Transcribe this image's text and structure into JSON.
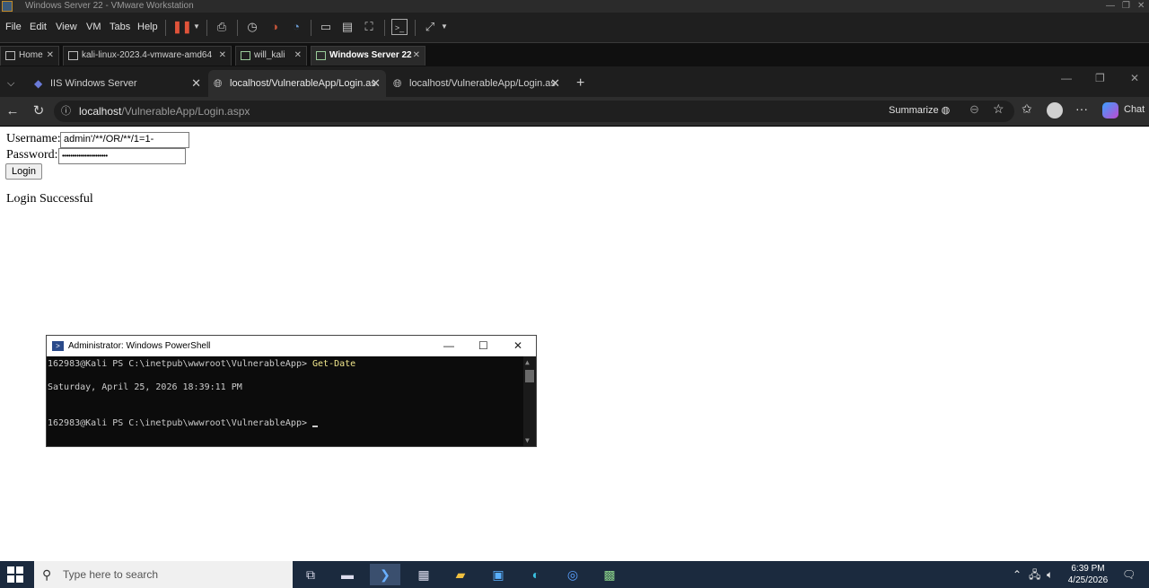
{
  "vmware": {
    "title": "Windows Server 22 - VMware Workstation",
    "menu": [
      "File",
      "Edit",
      "View",
      "VM",
      "Tabs",
      "Help"
    ],
    "tabs": [
      {
        "label": "Home",
        "active": false
      },
      {
        "label": "kali-linux-2023.4-vmware-amd64",
        "active": false
      },
      {
        "label": "will_kali",
        "active": false
      },
      {
        "label": "Windows Server 22",
        "active": true
      }
    ]
  },
  "browser": {
    "tabs": [
      {
        "label": "IIS Windows Server",
        "active": false
      },
      {
        "label": "localhost/VulnerableApp/Login.as",
        "active": true
      },
      {
        "label": "localhost/VulnerableApp/Login.as",
        "active": false
      }
    ],
    "address": {
      "host": "localhost",
      "path": "/VulnerableApp/Login.aspx"
    },
    "summarize_label": "Summarize",
    "chat_label": "Chat"
  },
  "page": {
    "username_label": "Username:",
    "username_value": "admin'/**/OR/**/1=1-",
    "password_label": "Password:",
    "password_value": "••••••••••••••••••••••",
    "login_button": "Login",
    "message": "Login Successful"
  },
  "powershell": {
    "title": "Administrator: Windows PowerShell",
    "line1_prompt": "162983@Kali PS C:\\inetpub\\wwwroot\\VulnerableApp> ",
    "line1_cmd": "Get-Date",
    "line2": "Saturday, April 25, 2026 18:39:11 PM",
    "line3_prompt": "162983@Kali PS C:\\inetpub\\wwwroot\\VulnerableApp> "
  },
  "taskbar": {
    "search_placeholder": "Type here to search",
    "time": "6:39 PM",
    "date": "4/25/2026"
  },
  "colors": {
    "taskbar": "#1b2a3e",
    "ps_background": "#0c0c0c",
    "ps_command": "#f0e68c"
  }
}
